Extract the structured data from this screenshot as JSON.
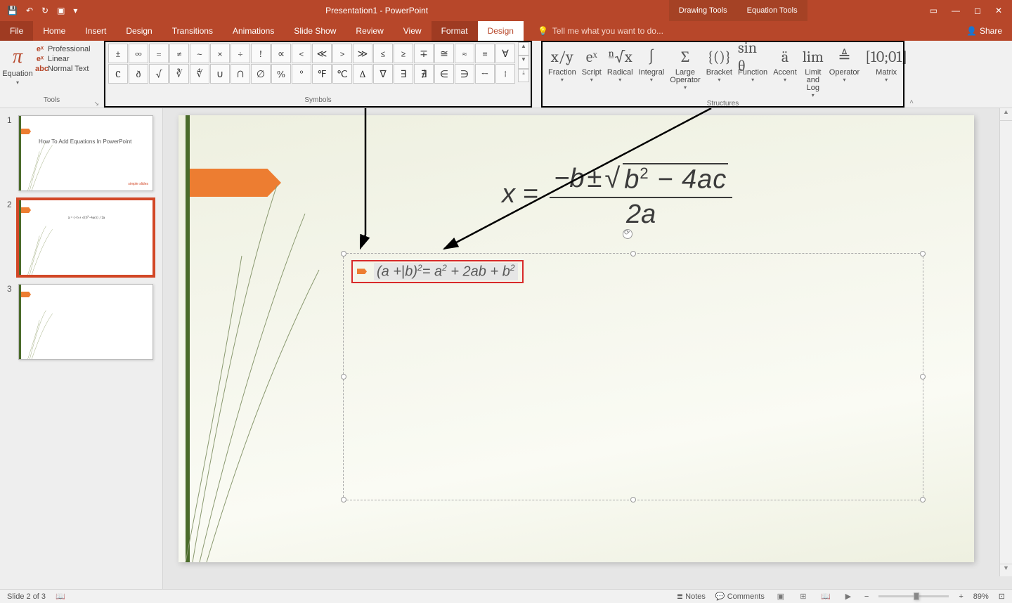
{
  "titlebar": {
    "qat": [
      "save-icon",
      "undo-icon",
      "redo-icon",
      "start-from-beginning-icon",
      "more-icon"
    ],
    "title": "Presentation1 - PowerPoint",
    "contextual": {
      "drawing": "Drawing Tools",
      "equation": "Equation Tools"
    },
    "winctrl": [
      "ribbon-options-icon",
      "minimize-icon",
      "maximize-icon",
      "close-icon"
    ]
  },
  "tabs": {
    "file": "File",
    "home": "Home",
    "insert": "Insert",
    "design": "Design",
    "transitions": "Transitions",
    "animations": "Animations",
    "slideshow": "Slide Show",
    "review": "Review",
    "view": "View",
    "format": "Format",
    "eqdesign": "Design",
    "tell_placeholder": "Tell me what you want to do...",
    "share": "Share"
  },
  "ribbon": {
    "tools": {
      "label": "Tools",
      "equation": "Equation",
      "professional": "Professional",
      "linear": "Linear",
      "normal": "Normal Text"
    },
    "symbols": {
      "label": "Symbols",
      "row1": [
        "±",
        "∞",
        "=",
        "≠",
        "~",
        "×",
        "÷",
        "!",
        "∝",
        "<",
        "≪",
        ">",
        "≫",
        "≤",
        "≥",
        "∓",
        "≅",
        "≈",
        "≡",
        "∀"
      ],
      "row2": [
        "C",
        "ð",
        "√",
        "∛",
        "∜",
        "∪",
        "∩",
        "∅",
        "%",
        "°",
        "℉",
        "℃",
        "∆",
        "∇",
        "∃",
        "∄",
        "∈",
        "∋",
        "←",
        "↑"
      ]
    },
    "structures": {
      "label": "Structures",
      "items": [
        {
          "name": "Fraction",
          "icon": "x/y"
        },
        {
          "name": "Script",
          "icon": "eˣ"
        },
        {
          "name": "Radical",
          "icon": "ⁿ√x"
        },
        {
          "name": "Integral",
          "icon": "∫"
        },
        {
          "name": "Large Operator",
          "icon": "Σ"
        },
        {
          "name": "Bracket",
          "icon": "{()}"
        },
        {
          "name": "Function",
          "icon": "sin θ"
        },
        {
          "name": "Accent",
          "icon": "ä"
        },
        {
          "name": "Limit and Log",
          "icon": "lim"
        },
        {
          "name": "Operator",
          "icon": "≜"
        },
        {
          "name": "Matrix",
          "icon": "[10;01]"
        }
      ]
    }
  },
  "thumbs": {
    "slide1": {
      "title": "How To Add Equations In PowerPoint",
      "brand": "simple slides"
    },
    "slide2_eq": "x = (−b ± √(b²−4ac)) / 2a"
  },
  "slide": {
    "quad_formula": "x = (−b ± √(b² − 4ac)) / 2a",
    "binomial": "(a + b)² = a² + 2ab + b²",
    "quad_parts": {
      "lhs": "x =",
      "neg_b": "−b",
      "pm": "±",
      "sqrt": "√",
      "inside1": "b",
      "inside_exp": "2",
      "inside2": " − 4ac",
      "den": "2a"
    },
    "binom_parts": {
      "left": "(a +",
      "cursor": "|",
      "right": "b)",
      "exp": "2",
      "eq": "= a",
      "exp2": "2",
      "mid": " + 2ab + b",
      "exp3": "2"
    }
  },
  "status": {
    "slide_of": "Slide 2 of 3",
    "notes": "Notes",
    "comments": "Comments",
    "zoom": "89%"
  }
}
